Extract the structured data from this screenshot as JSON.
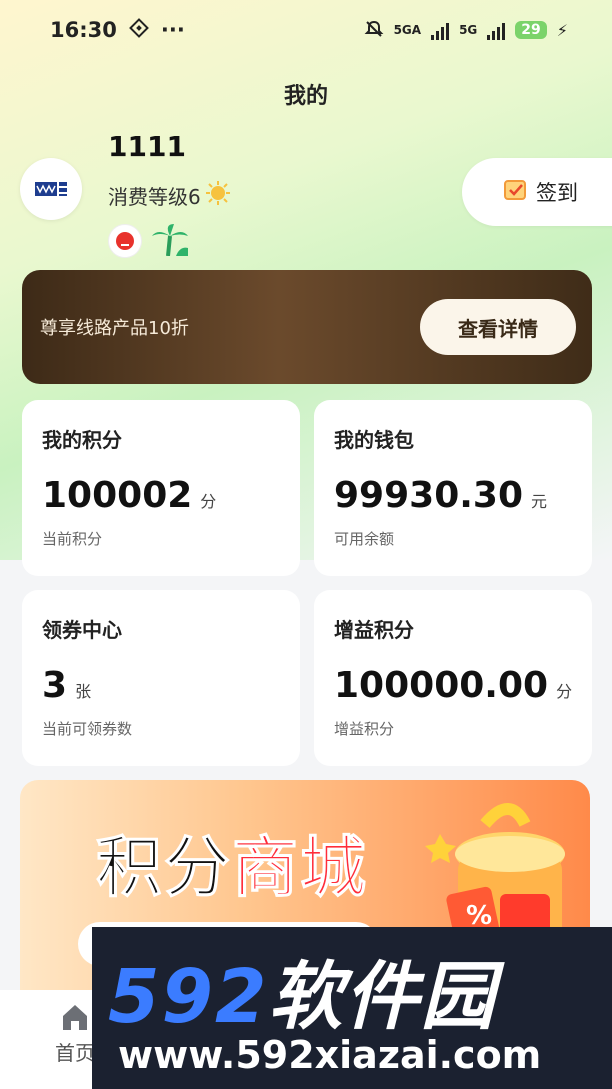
{
  "status_bar": {
    "time": "16:30",
    "more": "···",
    "signal1": "5GA",
    "signal2": "5G",
    "battery": "29"
  },
  "header": {
    "title": "我的"
  },
  "profile": {
    "username": "1111",
    "level": "消费等级6",
    "checkin_label": "签到"
  },
  "banner": {
    "text": "尊享线路产品10折",
    "button": "查看详情"
  },
  "cards": {
    "points": {
      "title": "我的积分",
      "value": "100002",
      "unit": "分",
      "sub": "当前积分"
    },
    "wallet": {
      "title": "我的钱包",
      "value": "99930.30",
      "unit": "元",
      "sub": "可用余额"
    },
    "coupons": {
      "title": "领券中心",
      "value": "3",
      "unit": "张",
      "sub": "当前可领券数"
    },
    "bonus": {
      "title": "增益积分",
      "value": "100000.00",
      "unit": "分",
      "sub": "增益积分"
    }
  },
  "mall": {
    "title_a": "积分",
    "title_b": "商城"
  },
  "tabbar": {
    "home": "首页"
  },
  "watermark": {
    "brand_num": "592",
    "brand_text": "软件园",
    "url": "www.592xiazai.com"
  },
  "colors": {
    "accent_green": "#c9f2c0",
    "banner_brown": "#4a331d",
    "mall_orange": "#ff8a4a",
    "mall_red": "#ff2d3a"
  }
}
